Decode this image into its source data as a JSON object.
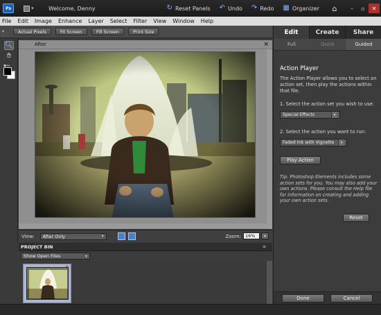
{
  "titlebar": {
    "welcome": "Welcome, Denny",
    "reset_panels": "Reset Panels",
    "undo": "Undo",
    "redo": "Redo",
    "organizer": "Organizer"
  },
  "menu": [
    "File",
    "Edit",
    "Image",
    "Enhance",
    "Layer",
    "Select",
    "Filter",
    "View",
    "Window",
    "Help"
  ],
  "options": {
    "actual_pixels": "Actual Pixels",
    "fit_screen": "Fit Screen",
    "fill_screen": "Fill Screen",
    "print_size": "Print Size"
  },
  "document": {
    "tab_label": "After"
  },
  "viewbar": {
    "view_label": "View:",
    "view_value": "After Only",
    "zoom_label": "Zoom:",
    "zoom_value": "16%"
  },
  "project_bin": {
    "title": "PROJECT BIN",
    "show_value": "Show Open Files"
  },
  "panel": {
    "tabs": [
      "Edit",
      "Create",
      "Share"
    ],
    "active_tab": "Edit",
    "subtabs": [
      "Full",
      "Quick",
      "Guided"
    ],
    "active_subtab": "Guided",
    "title": "Action Player",
    "intro": "The Action Player allows you to select an action set, then play the actions within that file.",
    "step1": "1. Select the action set you wish to use:",
    "set_value": "Special Effects",
    "step2": "2. Select the action you want to run:",
    "action_value": "Faded Ink with Vignette",
    "play_button": "Play Action",
    "tip": "Tip: Photoshop Elements includes some action sets for you. You may also add your own actions. Please consult the Help file for information on creating and adding your own action sets.",
    "reset_button": "Reset",
    "done_button": "Done",
    "cancel_button": "Cancel"
  },
  "colors": {
    "accent": "#1d5fb0",
    "panel_bg": "#3c3c3c",
    "canvas_bg": "#8f8f8f",
    "menu_bg": "#dcdcdc"
  },
  "icons": [
    "photoshop-logo-icon",
    "workspace-icon",
    "reset-panels-icon",
    "undo-icon",
    "redo-icon",
    "organizer-icon",
    "home-icon",
    "zoom-tool-icon",
    "hand-tool-icon",
    "close-icon"
  ]
}
